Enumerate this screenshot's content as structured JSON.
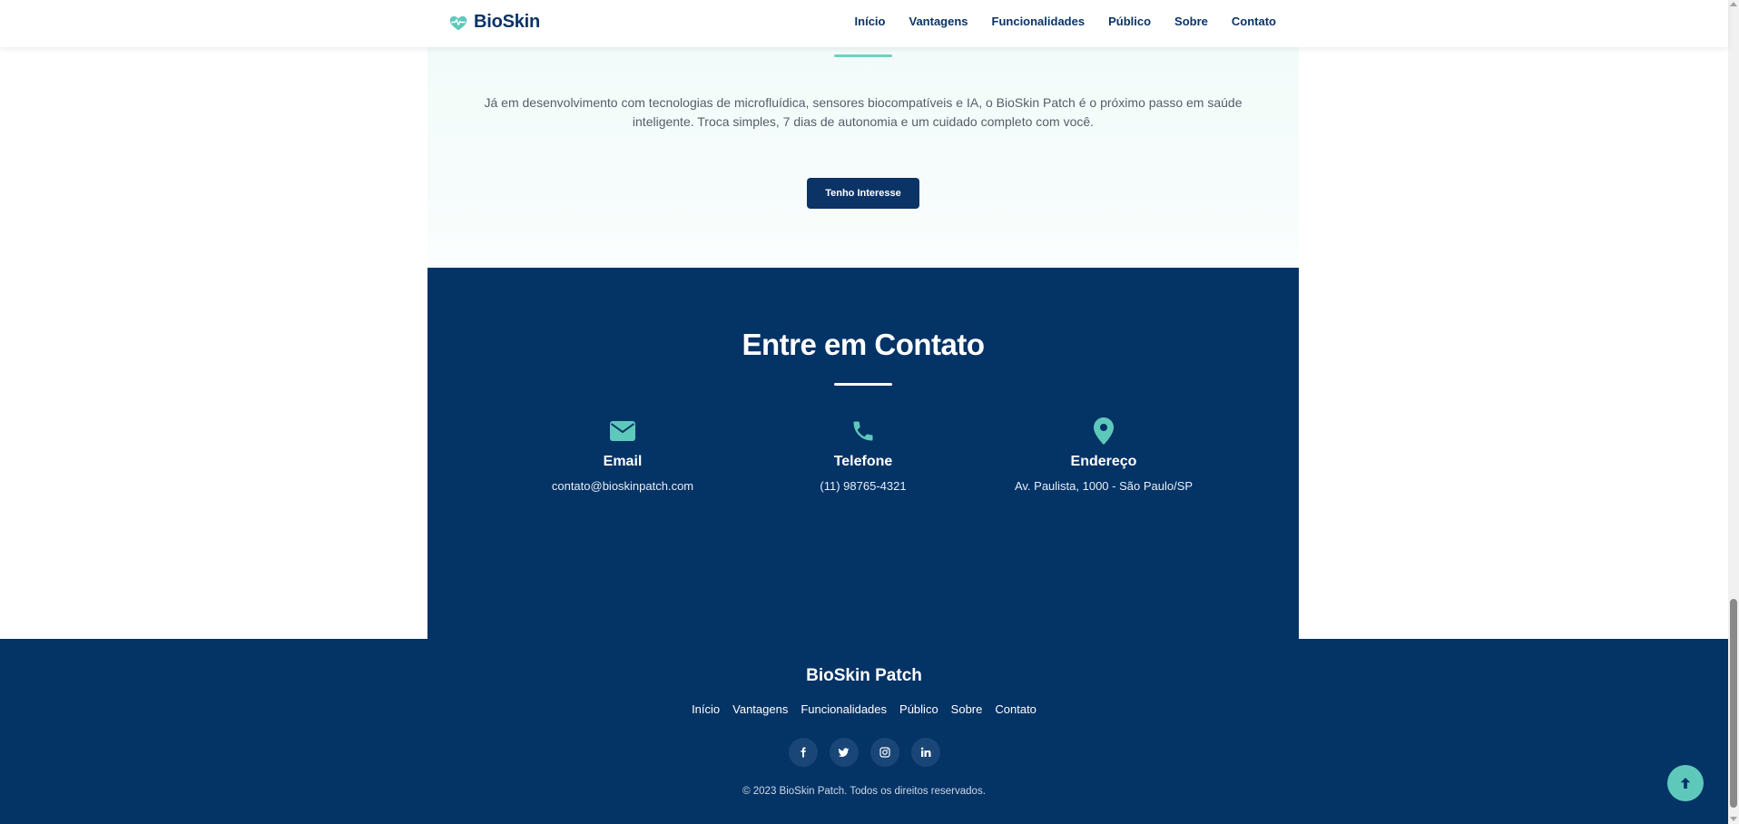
{
  "header": {
    "brand": "BioSkin",
    "nav": [
      "Início",
      "Vantagens",
      "Funcionalidades",
      "Público",
      "Sobre",
      "Contato"
    ]
  },
  "intro": {
    "text": "Já em desenvolvimento com tecnologias de microfluídica, sensores biocompatíveis e IA, o BioSkin Patch é o próximo passo em saúde inteligente. Troca simples, 7 dias de autonomia e um cuidado completo com você.",
    "cta_label": "Tenho Interesse"
  },
  "contact": {
    "title": "Entre em Contato",
    "items": [
      {
        "icon": "envelope-icon",
        "title": "Email",
        "value": "contato@bioskinpatch.com"
      },
      {
        "icon": "phone-icon",
        "title": "Telefone",
        "value": "(11) 98765-4321"
      },
      {
        "icon": "map-pin-icon",
        "title": "Endereço",
        "value": "Av. Paulista, 1000 - São Paulo/SP"
      }
    ]
  },
  "footer": {
    "brand": "BioSkin Patch",
    "nav": [
      "Início",
      "Vantagens",
      "Funcionalidades",
      "Público",
      "Sobre",
      "Contato"
    ],
    "socials": [
      {
        "icon": "facebook-icon",
        "glyph": "f"
      },
      {
        "icon": "twitter-icon",
        "glyph": "t"
      },
      {
        "icon": "instagram-icon",
        "glyph": "◎"
      },
      {
        "icon": "linkedin-icon",
        "glyph": "in"
      }
    ],
    "copyright": "© 2023 BioSkin Patch. Todos os direitos reservados."
  },
  "colors": {
    "navy": "#043366",
    "accent": "#5ec9bb",
    "brand_text": "#0b3366"
  },
  "back_to_top_icon": "arrow-up-icon"
}
